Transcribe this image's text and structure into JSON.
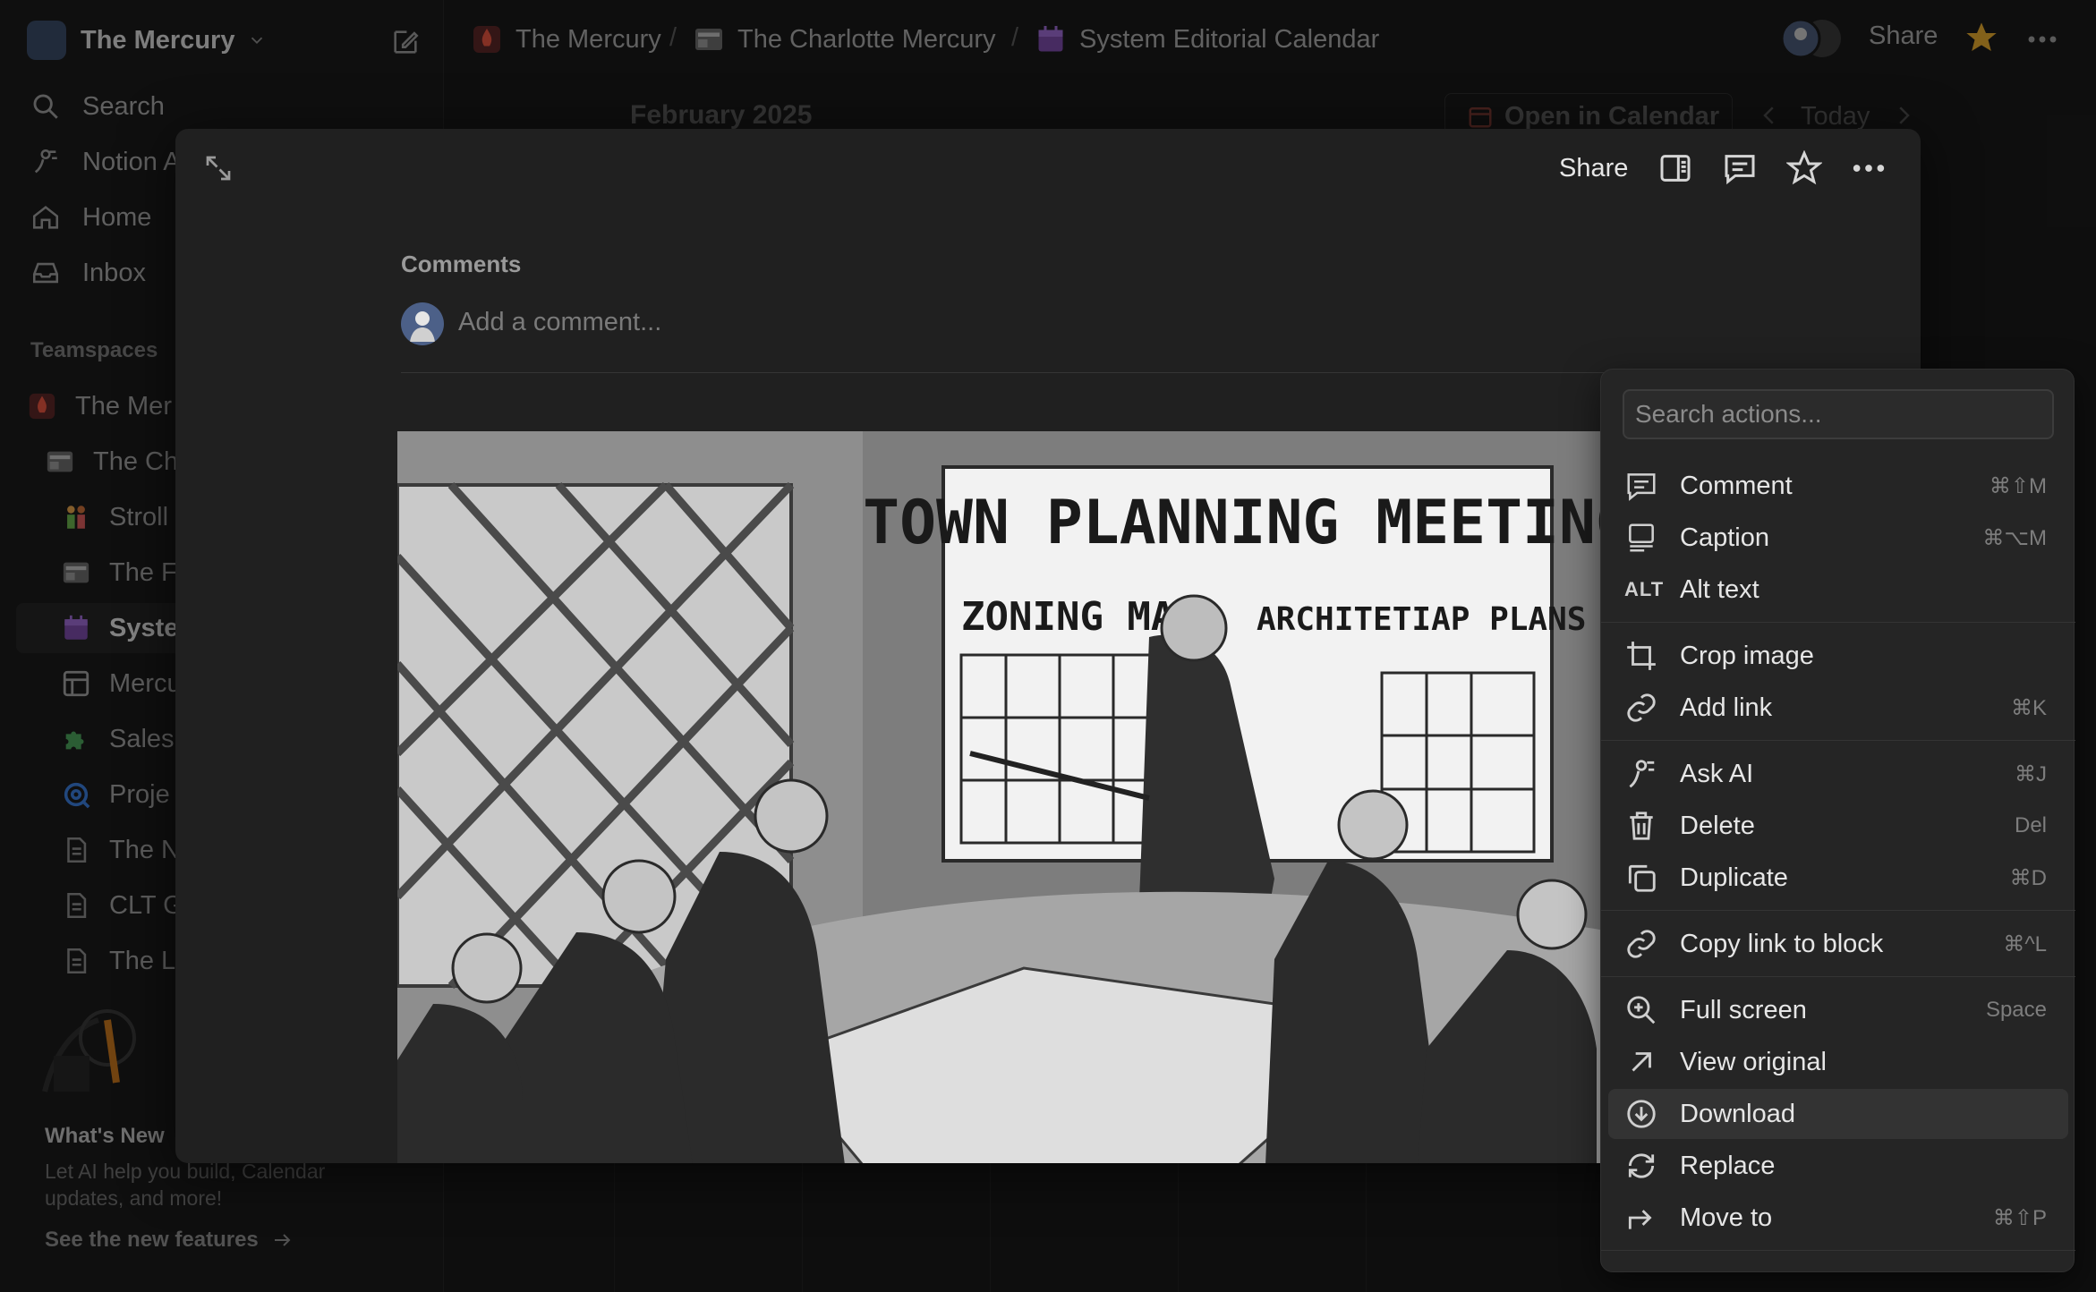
{
  "sidebar": {
    "workspace_name": "The Mercury",
    "nav": [
      {
        "label": "Search",
        "icon": "search-icon"
      },
      {
        "label": "Notion A",
        "icon": "notion-ai-icon"
      },
      {
        "label": "Home",
        "icon": "home-icon"
      },
      {
        "label": "Inbox",
        "icon": "inbox-icon"
      }
    ],
    "teamspaces_label": "Teamspaces",
    "pages": [
      {
        "label": "The Mer",
        "icon": "mercury-flame-icon"
      },
      {
        "label": "The Ch",
        "icon": "newspaper-icon"
      },
      {
        "label": "Stroll",
        "icon": "people-icon"
      },
      {
        "label": "The F",
        "icon": "newspaper-icon"
      },
      {
        "label": "Syste",
        "icon": "calendar-icon"
      },
      {
        "label": "Mercu",
        "icon": "table-icon"
      },
      {
        "label": "Sales",
        "icon": "puzzle-icon"
      },
      {
        "label": "Proje",
        "icon": "target-icon"
      },
      {
        "label": "The N",
        "icon": "page-icon"
      },
      {
        "label": "CLT G",
        "icon": "page-icon"
      },
      {
        "label": "The L",
        "icon": "page-icon"
      }
    ],
    "whats_new_title": "What's New",
    "whats_new_desc": "Let AI help you build, Calendar updates, and more!",
    "see_features": "See the new features"
  },
  "breadcrumb": [
    {
      "label": "The Mercury",
      "icon": "mercury-flame-icon"
    },
    {
      "label": "The Charlotte Mercury",
      "icon": "newspaper-icon"
    },
    {
      "label": "System Editorial Calendar",
      "icon": "calendar-icon"
    }
  ],
  "breadcrumb_sep": "/",
  "topbar": {
    "share": "Share"
  },
  "calendar": {
    "month": "February 2025",
    "open_in_calendar": "Open in Calendar",
    "today": "Today"
  },
  "modal": {
    "share": "Share",
    "comments_heading": "Comments",
    "add_comment_placeholder": "Add a comment...",
    "image_text": {
      "title": "TOWN PLANNING MEETING",
      "left": "ZONING MAP",
      "right": "ARCHITETIAP PLANS"
    }
  },
  "menu": {
    "search_placeholder": "Search actions...",
    "items": [
      {
        "label": "Comment",
        "shortcut": "⌘⇧M",
        "icon": "comment-icon"
      },
      {
        "label": "Caption",
        "shortcut": "⌘⌥M",
        "icon": "caption-icon"
      },
      {
        "label": "Alt text",
        "shortcut": "",
        "icon": "alt-text-icon",
        "icon_text": "ALT"
      },
      {
        "label": "Crop image",
        "shortcut": "",
        "icon": "crop-icon"
      },
      {
        "label": "Add link",
        "shortcut": "⌘K",
        "icon": "link-icon"
      },
      {
        "label": "Ask AI",
        "shortcut": "⌘J",
        "icon": "ai-icon"
      },
      {
        "label": "Delete",
        "shortcut": "Del",
        "icon": "trash-icon"
      },
      {
        "label": "Duplicate",
        "shortcut": "⌘D",
        "icon": "duplicate-icon"
      },
      {
        "label": "Copy link to block",
        "shortcut": "⌘^L",
        "icon": "link-icon"
      },
      {
        "label": "Full screen",
        "shortcut": "Space",
        "icon": "zoom-icon"
      },
      {
        "label": "View original",
        "shortcut": "",
        "icon": "arrow-up-right-icon"
      },
      {
        "label": "Download",
        "shortcut": "",
        "icon": "download-icon"
      },
      {
        "label": "Replace",
        "shortcut": "",
        "icon": "replace-icon"
      },
      {
        "label": "Move to",
        "shortcut": "⌘⇧P",
        "icon": "move-to-icon"
      }
    ],
    "highlighted": "Download"
  },
  "colors": {
    "background": "#191919",
    "modal": "#202020",
    "menu": "#252525",
    "favorite_star": "#e2a72e"
  }
}
